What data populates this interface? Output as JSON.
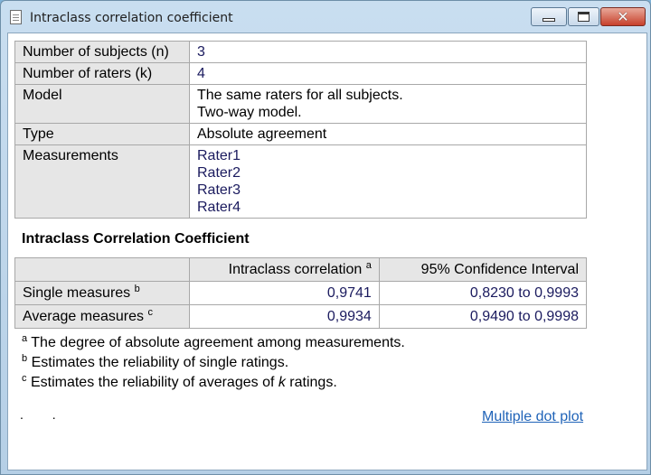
{
  "window": {
    "title": "Intraclass correlation coefficient",
    "close_glyph": "✕"
  },
  "info_rows": [
    {
      "label": "Number of subjects (n)",
      "values": [
        "3"
      ]
    },
    {
      "label": "Number of raters (k)",
      "values": [
        "4"
      ]
    },
    {
      "label": "Model",
      "values": [
        "The same raters for all subjects.",
        "Two-way model."
      ]
    },
    {
      "label": "Type",
      "values": [
        "Absolute agreement"
      ]
    },
    {
      "label": "Measurements",
      "values": [
        "Rater1",
        "Rater2",
        "Rater3",
        "Rater4"
      ]
    }
  ],
  "icc": {
    "title": "Intraclass Correlation Coefficient",
    "headers": {
      "col1": "Intraclass correlation",
      "col1_sup": "a",
      "col2": "95% Confidence Interval"
    },
    "rows": [
      {
        "label": "Single measures",
        "sup": "b",
        "icc": "0,9741",
        "ci": "0,8230 to 0,9993"
      },
      {
        "label": "Average measures",
        "sup": "c",
        "icc": "0,9934",
        "ci": "0,9490 to 0,9998"
      }
    ]
  },
  "footnotes": {
    "a": {
      "sup": "a",
      "text": "The degree of absolute agreement among measurements."
    },
    "b": {
      "sup": "b",
      "text": "Estimates the reliability of single ratings."
    },
    "c": {
      "sup": "c",
      "pre": "Estimates the reliability of averages of ",
      "em": "k",
      "post": " ratings."
    }
  },
  "footer": {
    "dots": ". .",
    "link": "Multiple dot plot"
  }
}
